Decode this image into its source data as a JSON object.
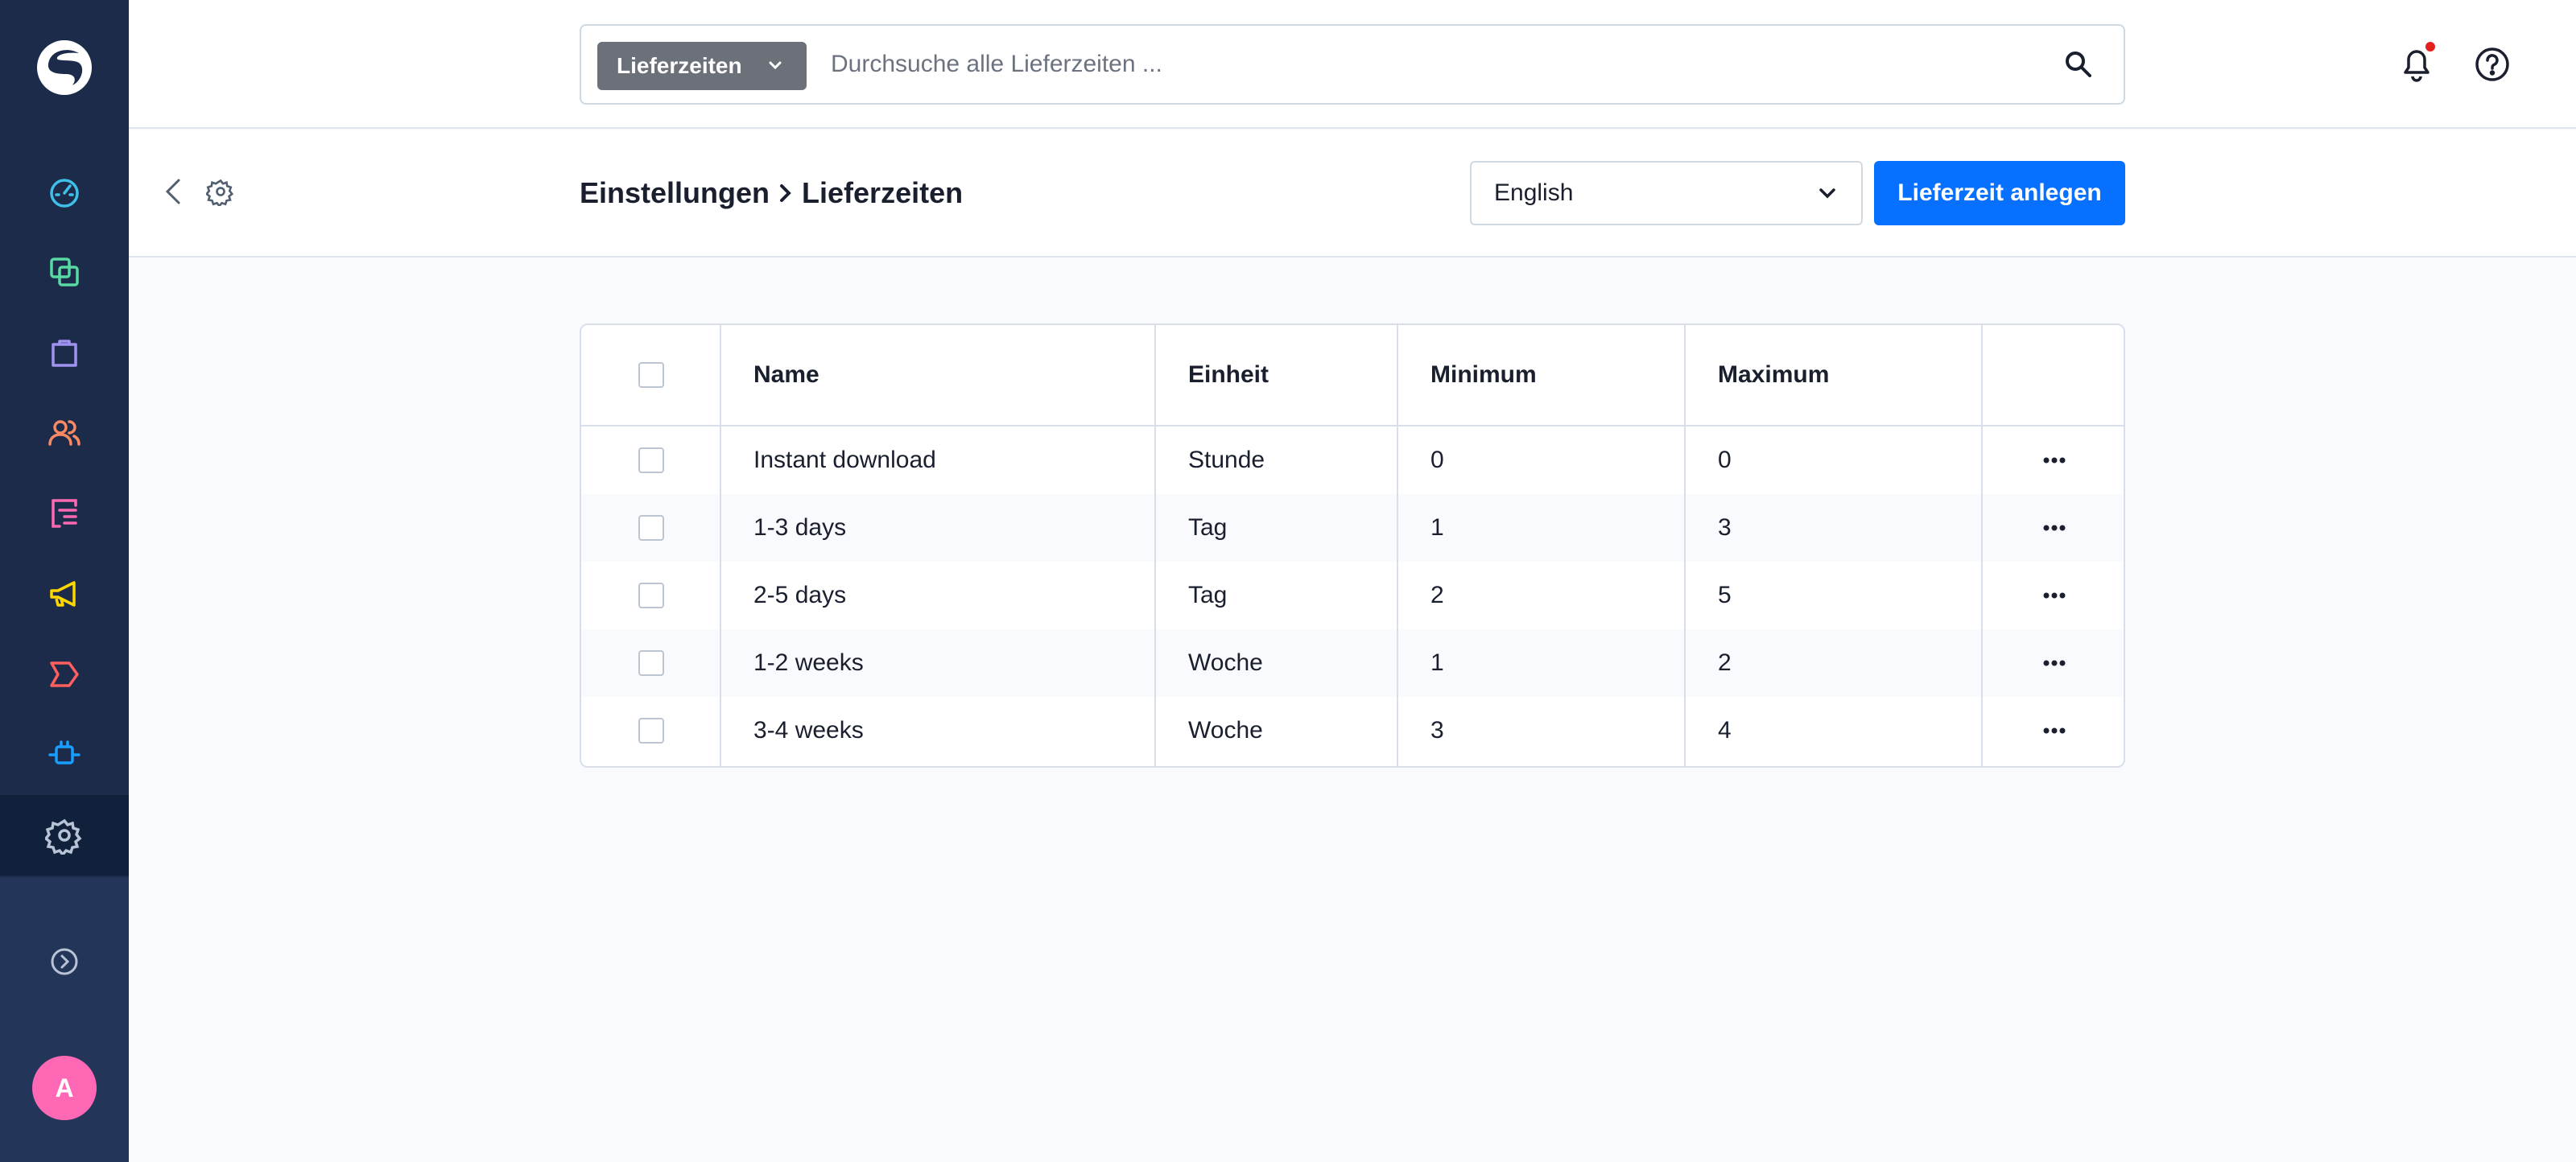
{
  "search": {
    "type_label": "Lieferzeiten",
    "placeholder": "Durchsuche alle Lieferzeiten ..."
  },
  "header": {
    "breadcrumb_parent": "Einstellungen",
    "breadcrumb_current": "Lieferzeiten"
  },
  "language": {
    "selected": "English"
  },
  "actions": {
    "create_label": "Lieferzeit anlegen"
  },
  "user": {
    "avatar_initial": "A"
  },
  "table": {
    "columns": [
      "Name",
      "Einheit",
      "Minimum",
      "Maximum"
    ],
    "rows": [
      {
        "name": "Instant download",
        "unit": "Stunde",
        "min": "0",
        "max": "0"
      },
      {
        "name": "1-3 days",
        "unit": "Tag",
        "min": "1",
        "max": "3"
      },
      {
        "name": "2-5 days",
        "unit": "Tag",
        "min": "2",
        "max": "5"
      },
      {
        "name": "1-2 weeks",
        "unit": "Woche",
        "min": "1",
        "max": "2"
      },
      {
        "name": "3-4 weeks",
        "unit": "Woche",
        "min": "3",
        "max": "4"
      }
    ]
  },
  "colors": {
    "sidebar": "#1b2b49",
    "primary": "#0870ff",
    "avatar": "#ff68b4",
    "notification_dot": "#e32020"
  },
  "icons": {
    "nav": [
      "dashboard-icon",
      "catalogues-icon",
      "orders-icon",
      "customers-icon",
      "content-icon",
      "marketing-icon",
      "sales-channel-icon",
      "extensions-icon",
      "settings-icon"
    ]
  }
}
